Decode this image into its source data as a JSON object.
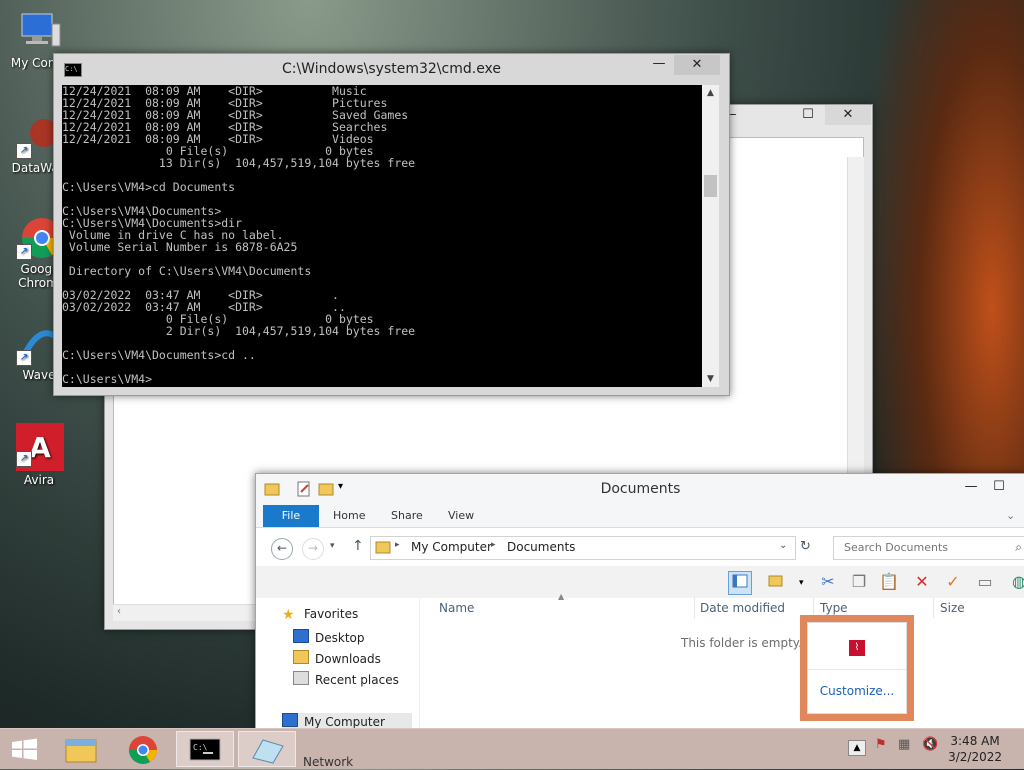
{
  "desktop": {
    "icons": [
      {
        "label": "My Comp",
        "icon": "monitor-icon"
      },
      {
        "label": "DataWag",
        "icon": "datawag-icon"
      },
      {
        "label": "Googl Chrom",
        "icon": "chrome-icon"
      },
      {
        "label": "Wave",
        "icon": "wave-icon"
      },
      {
        "label": "Avira",
        "icon": "avira-icon"
      }
    ]
  },
  "cmd": {
    "title": "C:\\Windows\\system32\\cmd.exe",
    "lines": [
      "12/24/2021  08:09 AM    <DIR>          Music",
      "12/24/2021  08:09 AM    <DIR>          Pictures",
      "12/24/2021  08:09 AM    <DIR>          Saved Games",
      "12/24/2021  08:09 AM    <DIR>          Searches",
      "12/24/2021  08:09 AM    <DIR>          Videos",
      "               0 File(s)              0 bytes",
      "              13 Dir(s)  104,457,519,104 bytes free",
      "",
      "C:\\Users\\VM4>cd Documents",
      "",
      "C:\\Users\\VM4\\Documents>",
      "C:\\Users\\VM4\\Documents>dir",
      " Volume in drive C has no label.",
      " Volume Serial Number is 6878-6A25",
      "",
      " Directory of C:\\Users\\VM4\\Documents",
      "",
      "03/02/2022  03:47 AM    <DIR>          .",
      "03/02/2022  03:47 AM    <DIR>          ..",
      "               0 File(s)              0 bytes",
      "               2 Dir(s)  104,457,519,104 bytes free",
      "",
      "C:\\Users\\VM4\\Documents>cd ..",
      "",
      "C:\\Users\\VM4>"
    ]
  },
  "explorer": {
    "title": "Documents",
    "tabs": {
      "file": "File",
      "home": "Home",
      "share": "Share",
      "view": "View"
    },
    "breadcrumb": {
      "root": "My Computer",
      "current": "Documents"
    },
    "search_placeholder": "Search Documents",
    "columns": {
      "name": "Name",
      "date": "Date modified",
      "type": "Type",
      "size": "Size"
    },
    "empty_message": "This folder is empty.",
    "nav": {
      "favorites": "Favorites",
      "desktop": "Desktop",
      "downloads": "Downloads",
      "recent": "Recent places",
      "computer": "My Computer",
      "network": "Network"
    }
  },
  "customize_popup": {
    "link": "Customize..."
  },
  "taskbar": {
    "time": "3:48 AM",
    "date": "3/2/2022"
  },
  "colors": {
    "accent": "#1979ca",
    "highlight": "#e0875c"
  }
}
